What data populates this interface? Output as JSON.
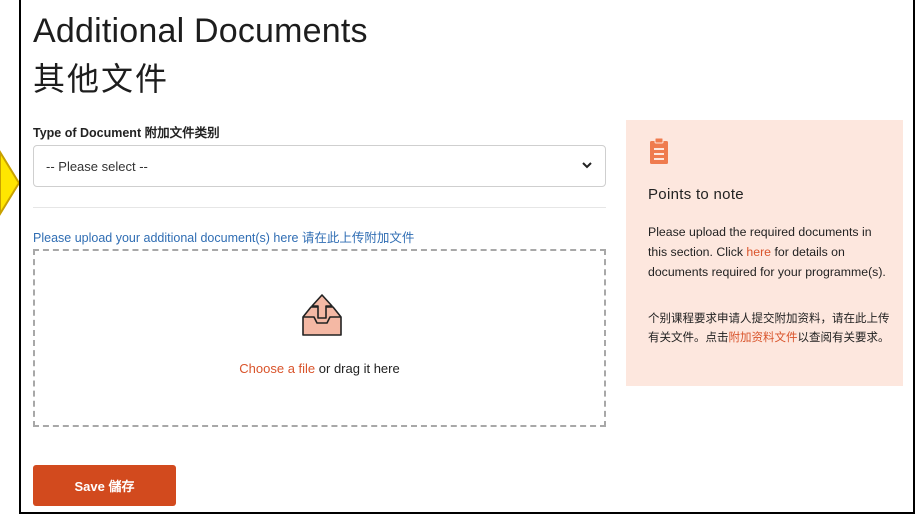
{
  "page": {
    "title_en": "Additional Documents",
    "title_zh": "其他文件"
  },
  "document_type": {
    "label": "Type of Document 附加文件类别",
    "selected": "-- Please select --"
  },
  "upload": {
    "label": "Please upload your additional document(s) here 请在此上传附加文件",
    "choose_link": "Choose a file",
    "drag_text": " or drag it here"
  },
  "actions": {
    "save_label": "Save 儲存"
  },
  "notes": {
    "title": "Points to note",
    "en_before": "Please upload the required documents in this section. Click ",
    "en_link": "here",
    "en_after": " for details on documents required for your programme(s).",
    "zh_before": "个别课程要求申请人提交附加资料，请在此上传有关文件。点击",
    "zh_link": "附加资料文件",
    "zh_after": "以查阅有关要求。"
  },
  "colors": {
    "accent": "#d24a1e",
    "link_blue": "#2f6db3",
    "panel_bg": "#fde7de",
    "arrow_yellow": "#ffe600"
  }
}
